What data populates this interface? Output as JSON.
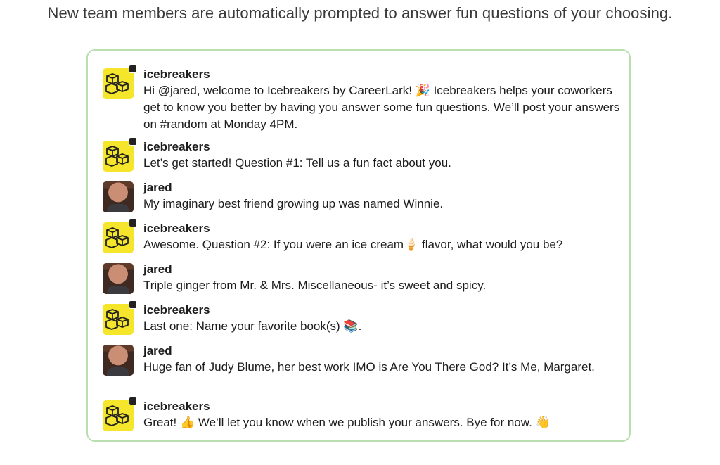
{
  "headline": "New team members are automatically prompted to answer fun questions of your choosing.",
  "messages": [
    {
      "author": "icebreakers",
      "avatar": "icebreakers-logo-icon",
      "text": "Hi @jared, welcome to Icebreakers by CareerLark! 🎉 Icebreakers helps your coworkers get to know you better by having you answer some fun questions. We’ll post your answers on #random at Monday 4PM."
    },
    {
      "author": "icebreakers",
      "avatar": "icebreakers-logo-icon",
      "text": "Let’s get started! Question #1: Tell us a fun fact about you."
    },
    {
      "author": "jared",
      "avatar": "user-photo",
      "text": "My imaginary best friend growing up was named Winnie."
    },
    {
      "author": "icebreakers",
      "avatar": "icebreakers-logo-icon",
      "text": "Awesome. Question #2: If you were an ice cream🍦 flavor, what would you be?"
    },
    {
      "author": "jared",
      "avatar": "user-photo",
      "text": "Triple ginger from Mr. & Mrs. Miscellaneous- it’s sweet and spicy."
    },
    {
      "author": "icebreakers",
      "avatar": "icebreakers-logo-icon",
      "text": "Last one: Name your favorite book(s) 📚."
    },
    {
      "author": "jared",
      "avatar": "user-photo",
      "text": "Huge fan of Judy Blume, her best work IMO is Are You There God? It’s Me, Margaret."
    },
    {
      "author": "icebreakers",
      "avatar": "icebreakers-logo-icon",
      "text": "Great! 👍 We’ll let you know when we publish your answers. Bye for now. 👋"
    }
  ],
  "colors": {
    "border": "#b9dfb0",
    "bot_avatar": "#f5e52b"
  }
}
